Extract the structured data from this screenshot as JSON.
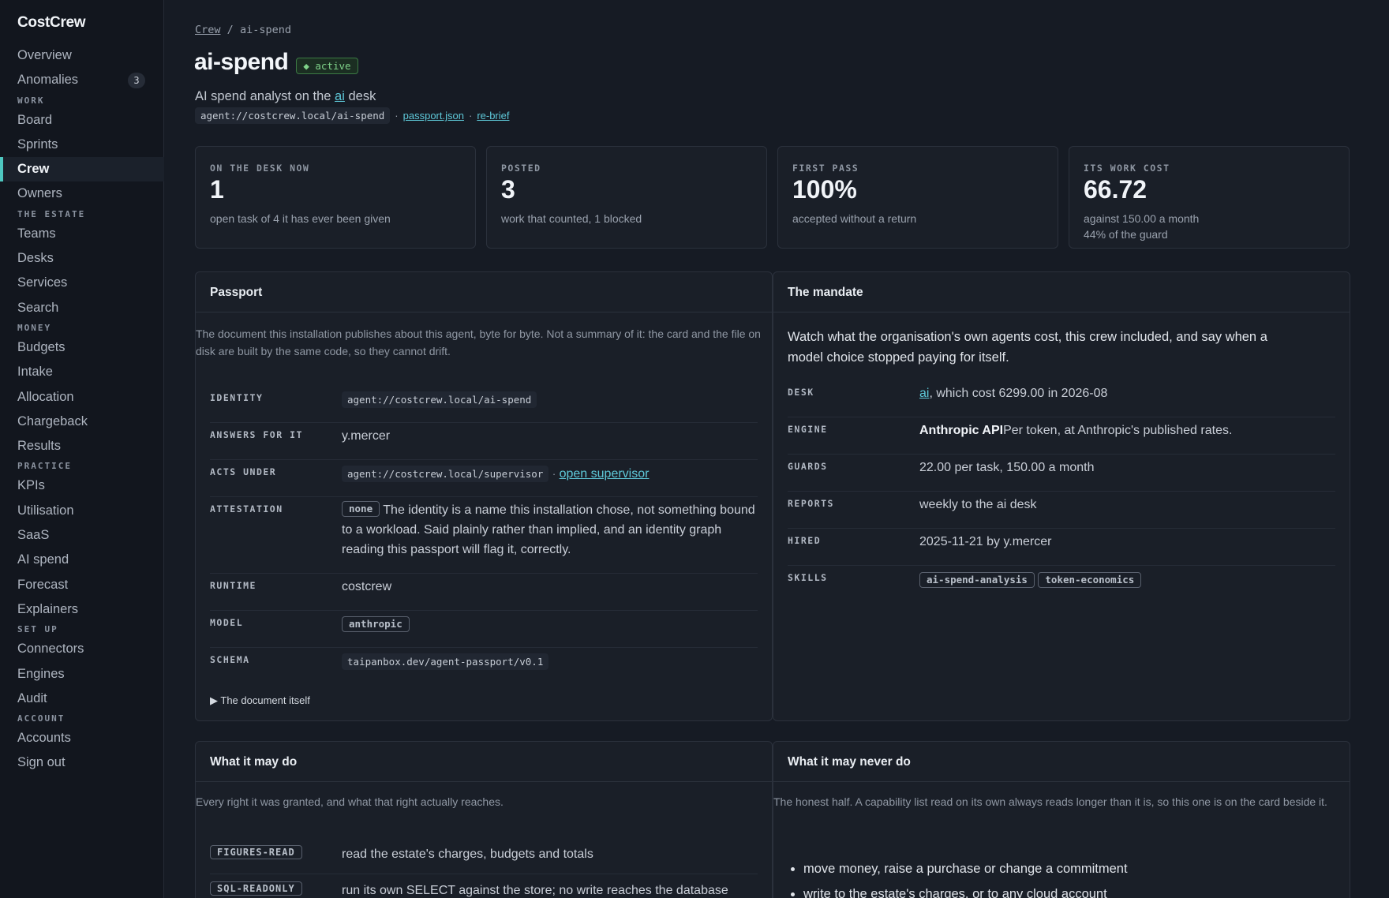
{
  "app": {
    "brand": "CostCrew"
  },
  "sidebar": {
    "overview": "Overview",
    "anomalies": "Anomalies",
    "anomalies_count": "3",
    "work_section": "WORK",
    "board": "Board",
    "sprints": "Sprints",
    "crew": "Crew",
    "owners": "Owners",
    "estate_section": "THE ESTATE",
    "teams": "Teams",
    "desks": "Desks",
    "services": "Services",
    "search": "Search",
    "money_section": "MONEY",
    "budgets": "Budgets",
    "intake": "Intake",
    "allocation": "Allocation",
    "chargeback": "Chargeback",
    "results": "Results",
    "practice_section": "PRACTICE",
    "kpis": "KPIs",
    "utilisation": "Utilisation",
    "saas": "SaaS",
    "ai_spend": "AI spend",
    "forecast": "Forecast",
    "explainers": "Explainers",
    "setup_section": "SET UP",
    "connectors": "Connectors",
    "engines": "Engines",
    "audit": "Audit",
    "account_section": "ACCOUNT",
    "accounts": "Accounts",
    "sign_out": "Sign out"
  },
  "breadcrumb": {
    "parent": "Crew",
    "sep": "/",
    "current": "ai-spend"
  },
  "header": {
    "title": "ai-spend",
    "status": "◆ active",
    "subtitle_pre": "AI spend analyst on the ",
    "subtitle_link": "ai",
    "subtitle_post": " desk",
    "uri": "agent://costcrew.local/ai-spend",
    "dot": "·",
    "passport_link": "passport.json",
    "rebrief_link": "re-brief"
  },
  "stats": [
    {
      "label": "ON THE DESK NOW",
      "value": "1",
      "note": "open task of 4 it has ever been given",
      "note2": ""
    },
    {
      "label": "POSTED",
      "value": "3",
      "note": "work that counted, 1 blocked",
      "note2": ""
    },
    {
      "label": "FIRST PASS",
      "value": "100%",
      "note": "accepted without a return",
      "note2": ""
    },
    {
      "label": "ITS WORK COST",
      "value": "66.72",
      "note": "against 150.00 a month",
      "note2": "44% of the guard"
    }
  ],
  "passport": {
    "title": "Passport",
    "description": "The document this installation publishes about this agent, byte for byte. Not a summary of it: the card and the file on disk are built by the same code, so they cannot drift.",
    "identity_key": "IDENTITY",
    "identity_val": "agent://costcrew.local/ai-spend",
    "answers_key": "ANSWERS FOR IT",
    "answers_val": "y.mercer",
    "acts_key": "ACTS UNDER",
    "acts_val": "agent://costcrew.local/supervisor",
    "acts_sep": "·",
    "acts_link": "open supervisor",
    "attest_key": "ATTESTATION",
    "attest_chip": "none",
    "attest_text": "The identity is a name this installation chose, not something bound to a workload. Said plainly rather than implied, and an identity graph reading this passport will flag it, correctly.",
    "runtime_key": "RUNTIME",
    "runtime_val": "costcrew",
    "model_key": "MODEL",
    "model_val": "anthropic",
    "schema_key": "SCHEMA",
    "schema_val": "taipanbox.dev/agent-passport/v0.1",
    "details": "▶ The document itself"
  },
  "mandate": {
    "title": "The mandate",
    "text": "Watch what the organisation's own agents cost, this crew included, and say when a model choice stopped paying for itself.",
    "desk_key": "DESK",
    "desk_link": "ai",
    "desk_rest": ", which cost 6299.00 in 2026-08",
    "engine_key": "ENGINE",
    "engine_name": "Anthropic API",
    "engine_rest": "Per token, at Anthropic's published rates.",
    "guards_key": "GUARDS",
    "guards_val": "22.00 per task, 150.00 a month",
    "reports_key": "REPORTS",
    "reports_val": "weekly to the ai desk",
    "hired_key": "HIRED",
    "hired_val": "2025-11-21 by y.mercer",
    "skills_key": "SKILLS",
    "skills": [
      "ai-spend-analysis",
      "token-economics"
    ]
  },
  "may_do": {
    "title": "What it may do",
    "description": "Every right it was granted, and what that right actually reaches.",
    "rows": [
      {
        "perm": "FIGURES-READ",
        "text": "read the estate's charges, budgets and totals"
      },
      {
        "perm": "SQL-READONLY",
        "text": "run its own SELECT against the store; no write reaches the database"
      }
    ]
  },
  "never_do": {
    "title": "What it may never do",
    "description": "The honest half. A capability list read on its own always reads longer than it is, so this one is on the card beside it.",
    "items": [
      "move money, raise a purchase or change a commitment",
      "write to the estate's charges, or to any cloud account"
    ]
  }
}
